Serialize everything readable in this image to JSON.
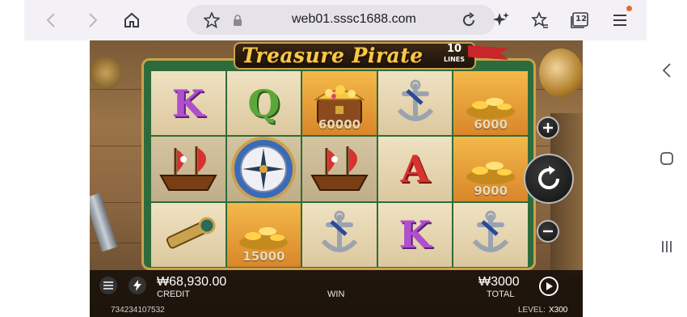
{
  "browser": {
    "url": "web01.sssc1688.com",
    "tab_count": "12"
  },
  "game": {
    "logo": "Treasure Pirate",
    "lines_count": "10",
    "lines_label": "LINES",
    "reels": [
      [
        {
          "sym": "K"
        },
        {
          "sym": "Q"
        },
        {
          "sym": "treasure-chest",
          "value": "60000"
        },
        {
          "sym": "anchor"
        },
        {
          "sym": "gold-coins",
          "value": "6000"
        }
      ],
      [
        {
          "sym": "pirate-ship"
        },
        {
          "sym": "compass"
        },
        {
          "sym": "pirate-ship"
        },
        {
          "sym": "A"
        },
        {
          "sym": "gold-coins",
          "value": "9000"
        }
      ],
      [
        {
          "sym": "spyglass"
        },
        {
          "sym": "gold-coins",
          "value": "15000"
        },
        {
          "sym": "anchor"
        },
        {
          "sym": "K"
        },
        {
          "sym": "anchor"
        }
      ]
    ],
    "credit_value": "₩68,930.00",
    "credit_label": "CREDIT",
    "win_label": "WIN",
    "total_value": "₩3000",
    "total_label": "TOTAL",
    "session_id": "734234107532",
    "level_label": "LEVEL:",
    "level_value": "X300"
  },
  "colors": {
    "gold": "#f6c847",
    "frame_green": "#2e6b3c",
    "browser_bg": "#f3f1f6"
  }
}
